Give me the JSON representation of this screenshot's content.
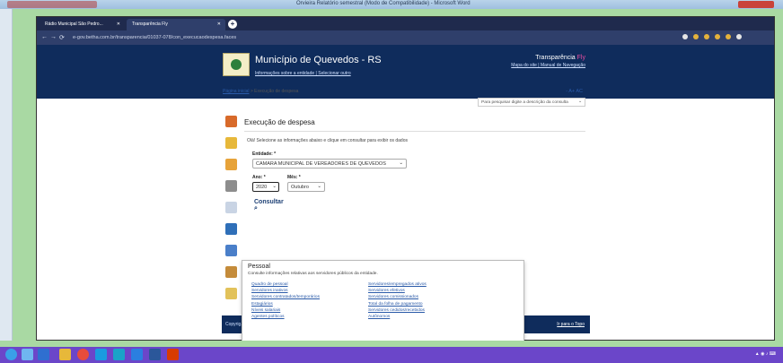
{
  "word": {
    "title": "Orvieira Relatório semestral (Modo de Compatibilidade) - Microsoft Word"
  },
  "browser": {
    "tabs": [
      {
        "label": "Rádio Municipal São Pedro..."
      },
      {
        "label": "Transparência Fly"
      }
    ],
    "url": "e-gov.betha.com.br/transparencia/01037-078/con_execucaodespesa.faces"
  },
  "site": {
    "municipality": "Município de Quevedos - RS",
    "sublinks": "Informações sobre a entidade | Selecionar outro",
    "brand": "Transparência",
    "brand_accent": "Fly",
    "brand_links": "Mapa do site | Manual de Navegação",
    "breadcrumb_home": "Página inicial",
    "breadcrumb_sep": ">",
    "breadcrumb_current": "Execução de despesa",
    "access": "- A+ AC",
    "search_placeholder": "Para pesquisar digite a descrição da consulta"
  },
  "page": {
    "title": "Execução de despesa",
    "intro": "Olá! Selecione as informações abaixo e clique em consultar para exibir os dados",
    "entidade_label": "Entidade: *",
    "entidade_value": "CAMARA MUNICIPAL DE VEREADORES DE QUEVEDOS",
    "ano_label": "Ano: *",
    "ano_value": "2020",
    "mes_label": "Mês: *",
    "mes_value": "Outubro",
    "consultar": "Consultar"
  },
  "popup": {
    "heading": "Pessoal",
    "desc": "Consulte informações relativas aos servidores públicos da entidade.",
    "col1": [
      "Quadro de pessoal",
      "Servidores inativos",
      "Servidores contratados/temporários",
      "Estagiários",
      "Níveis salariais",
      "Agentes políticos"
    ],
    "col2": [
      "Servidores/empregados ativos",
      "Servidores efetivos",
      "Servidores comissionados",
      "Total da folha de pagamento",
      "Servidores cedidos/recebidos",
      "Autônomos"
    ]
  },
  "footer": {
    "left": "Copyrig...",
    "right": "Ir para o Topo"
  },
  "colors": {
    "navy": "#0f2c5c",
    "accent": "#e94da0",
    "taskbar": "#6b46c9"
  }
}
